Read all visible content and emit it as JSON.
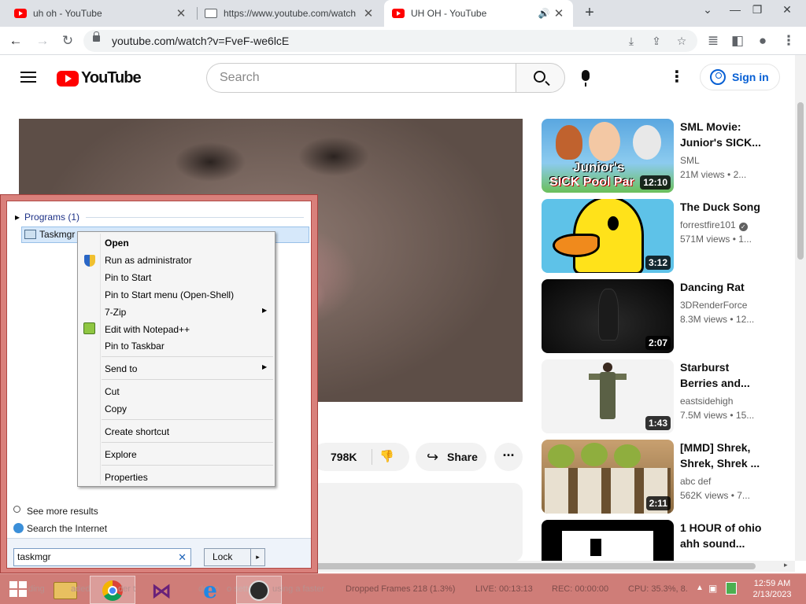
{
  "browser": {
    "tabs": [
      {
        "title": "uh oh - YouTube",
        "favicon": "youtube-favicon"
      },
      {
        "title": "https://www.youtube.com/watch",
        "favicon": "generic-page-favicon"
      },
      {
        "title": "UH OH - YouTube",
        "favicon": "youtube-favicon",
        "active": true,
        "audio": true
      }
    ],
    "url": "youtube.com/watch?v=FveF-we6lcE"
  },
  "youtube": {
    "logo_text": "YouTube",
    "search_placeholder": "Search",
    "signin_label": "Sign in",
    "likes": "798K",
    "share_label": "Share"
  },
  "related": [
    {
      "title": "SML Movie: Junior's SICK...",
      "channel": "SML",
      "views": "21M views",
      "age": "• 2...",
      "duration": "12:10",
      "thumb_text_top": "Junior's",
      "thumb_text_bottom": "SICK Pool Par"
    },
    {
      "title": "The Duck Song",
      "channel": "forrestfire101",
      "verified": true,
      "views": "571M views",
      "age": "• 1...",
      "duration": "3:12"
    },
    {
      "title": "Dancing Rat",
      "channel": "3DRenderForce",
      "views": "8.3M views",
      "age": "• 12...",
      "duration": "2:07"
    },
    {
      "title": "Starburst Berries and...",
      "channel": "eastsidehigh",
      "views": "7.5M views",
      "age": "• 15...",
      "duration": "1:43"
    },
    {
      "title": "[MMD] Shrek, Shrek, Shrek ...",
      "channel": "abc def",
      "views": "562K views",
      "age": "• 7...",
      "duration": "2:11"
    },
    {
      "title": "1 HOUR of ohio ahh sound...",
      "channel": "",
      "views": "",
      "age": "",
      "duration": ""
    }
  ],
  "startmenu": {
    "group_label": "Programs (1)",
    "result_label": "Taskmgr",
    "see_more": "See more results",
    "search_internet": "Search the Internet",
    "search_value": "taskmgr",
    "lock_label": "Lock"
  },
  "context_menu": {
    "open": "Open",
    "run_admin": "Run as administrator",
    "pin_start": "Pin to Start",
    "pin_start_menu": "Pin to Start menu (Open-Shell)",
    "zip": "7-Zip",
    "notepad": "Edit with Notepad++",
    "pin_taskbar": "Pin to Taskbar",
    "send_to": "Send to",
    "cut": "Cut",
    "copy": "Copy",
    "create_shortcut": "Create shortcut",
    "explore": "Explore",
    "properties": "Properties"
  },
  "taskbar": {
    "obs_dropped": "Dropped Frames 218 (1.3%)",
    "obs_live": "LIVE: 00:13:13",
    "obs_rec": "REC: 00:00:00",
    "obs_cpu": "CPU: 35.3%, 8.",
    "time": "12:59 AM",
    "date": "2/13/2023",
    "ghost_1": "ding",
    "ghost_2": "aded",
    "ghost_3": "der t",
    "ghost_4": "down",
    "ghost_5": "o sett",
    "ghost_6": "using a faster"
  }
}
